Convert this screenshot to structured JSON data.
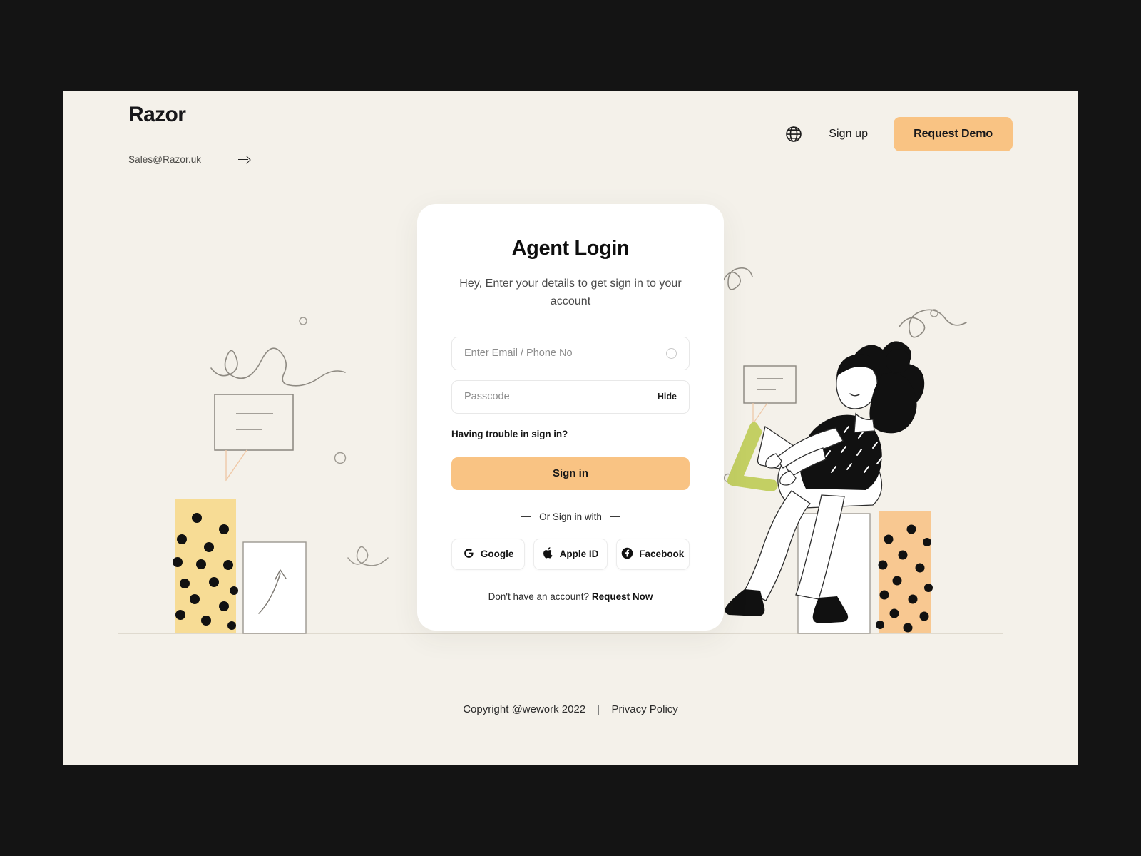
{
  "theme": {
    "frame_bg": "#141414",
    "page_bg": "#F4F1EA",
    "card_bg": "#FFFFFF",
    "accent_orange": "#F9C383",
    "bar_yellow": "#F7DC95",
    "bar_peach": "#F8C891",
    "laptop_green": "#C3CF63",
    "ink": "#17171A"
  },
  "header": {
    "logo": "Razor",
    "email": "Sales@Razor.uk",
    "email_arrow_icon": "arrow-right-icon",
    "globe_icon": "globe-icon",
    "signup_label": "Sign up",
    "demo_label": "Request Demo"
  },
  "card": {
    "title": "Agent Login",
    "subtitle": "Hey, Enter your details to get sign in to your account",
    "email_field": {
      "placeholder": "Enter Email / Phone No",
      "value": "",
      "trailing_icon": "circle-icon"
    },
    "password_field": {
      "placeholder": "Passcode",
      "value": "",
      "toggle_label": "Hide"
    },
    "trouble_label": "Having trouble in sign in?",
    "signin_label": "Sign in",
    "divider_label": "Or Sign in with",
    "social": [
      {
        "label": "Google",
        "icon": "google-icon"
      },
      {
        "label": "Apple ID",
        "icon": "apple-icon"
      },
      {
        "label": "Facebook",
        "icon": "facebook-icon"
      }
    ],
    "no_account_text": "Don't have an account?",
    "request_now_label": "Request Now"
  },
  "footer": {
    "copyright": "Copyright @wework 2022",
    "separator": "|",
    "privacy": "Privacy Policy"
  },
  "illustration": {
    "description": "Woman with hair bun sitting on a white block using a green laptop, flanked by polka-dot bars, speech bubbles, squiggles and circles"
  }
}
